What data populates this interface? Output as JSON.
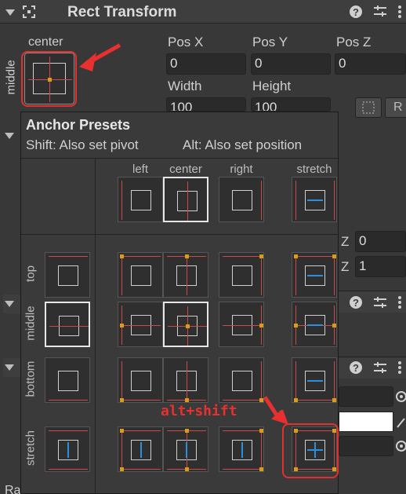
{
  "header": {
    "title": "Rect Transform",
    "icons": [
      "move-icon",
      "help-icon",
      "settings-sliders-icon",
      "more-menu-icon"
    ]
  },
  "rect": {
    "anchor_h": "center",
    "anchor_v": "middle",
    "pos_x_label": "Pos X",
    "pos_y_label": "Pos Y",
    "pos_z_label": "Pos Z",
    "pos_x": "0",
    "pos_y": "0",
    "pos_z": "0",
    "width_label": "Width",
    "height_label": "Height",
    "width": "100",
    "height": "100",
    "raw_label": "R"
  },
  "popup": {
    "title": "Anchor Presets",
    "hint_shift": "Shift: Also set pivot",
    "hint_alt": "Alt: Also set position",
    "columns": [
      "left",
      "center",
      "right",
      "stretch"
    ],
    "rows": [
      "top",
      "middle",
      "bottom",
      "stretch"
    ]
  },
  "annotation": "alt+shift",
  "background": {
    "z1": "Z",
    "z1_value": "0",
    "z2": "Z",
    "z2_value": "1",
    "bottom_section": "Raycast Padding"
  },
  "colors": {
    "highlight": "#e03030",
    "anchor_dot": "#d89b1a",
    "stretch_arrow": "#2d8fd8",
    "anchor_line": "#c94a4a"
  }
}
